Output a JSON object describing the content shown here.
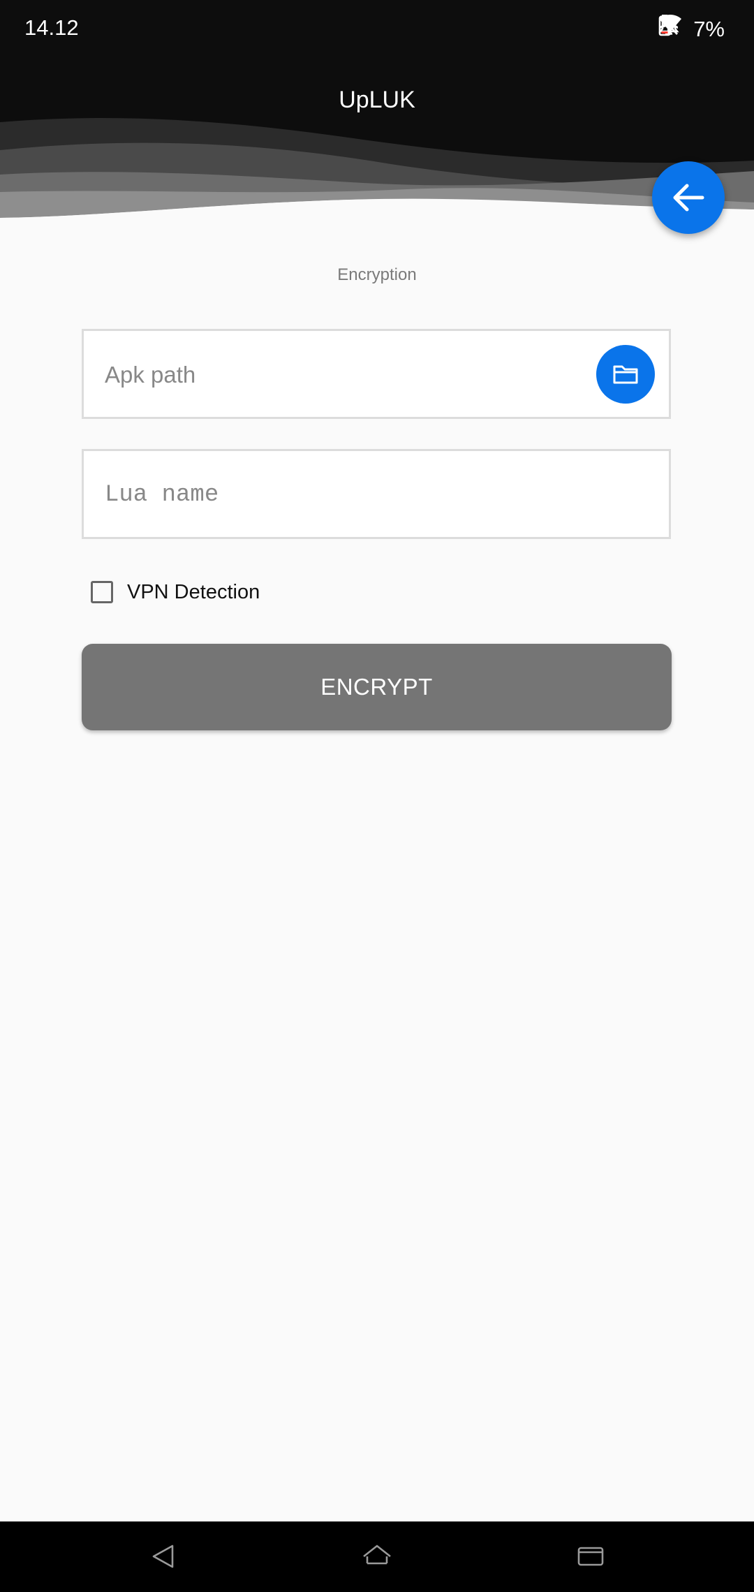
{
  "status_bar": {
    "time": "14.12",
    "battery_percent": "7%",
    "icons": [
      "notifications-off-icon",
      "wifi-icon",
      "airplane-mode-icon",
      "battery-icon"
    ]
  },
  "header": {
    "title": "UpLUK",
    "back_icon": "arrow-left-icon"
  },
  "main": {
    "section_label": "Encryption",
    "apk_field": {
      "value": "",
      "placeholder": "Apk path",
      "button_icon": "folder-icon"
    },
    "lua_field": {
      "value": "",
      "placeholder": "Lua name"
    },
    "vpn_detection": {
      "label": "VPN Detection",
      "checked": false
    },
    "encrypt_button": {
      "label": "ENCRYPT"
    }
  },
  "nav_bar": {
    "icons": [
      "nav-back-icon",
      "nav-home-icon",
      "nav-recents-icon"
    ]
  },
  "colors": {
    "accent": "#0a74ea",
    "header_bg": "#0d0d0d",
    "button_disabled": "#757575",
    "background": "#fafafa"
  }
}
